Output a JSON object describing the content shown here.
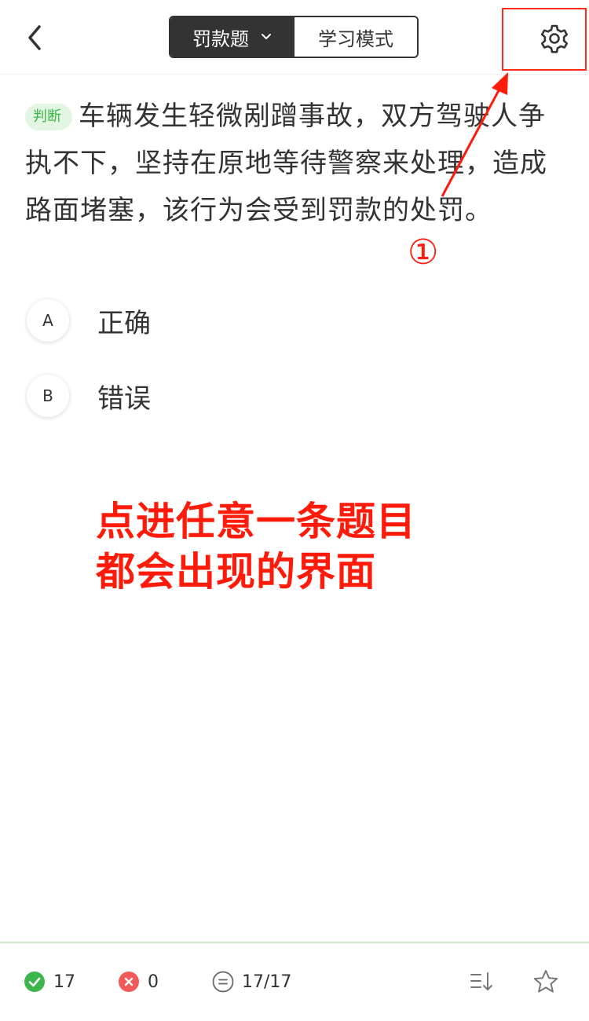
{
  "header": {
    "mode_left_label": "罚款题",
    "mode_right_label": "学习模式"
  },
  "question": {
    "type_tag": "判断",
    "text": "车辆发生轻微剐蹭事故，双方驾驶人争执不下，坚持在原地等待警察来处理，造成路面堵塞，该行为会受到罚款的处罚。"
  },
  "options": [
    {
      "letter": "A",
      "text": "正确"
    },
    {
      "letter": "B",
      "text": "错误"
    }
  ],
  "annotation": {
    "number": "①",
    "line1": "点进任意一条题目",
    "line2": "都会出现的界面",
    "color": "#ff1a0a"
  },
  "footer": {
    "correct_count": "17",
    "wrong_count": "0",
    "progress": "17/17"
  },
  "icons": {
    "back": "back-arrow-icon",
    "settings": "gear-icon",
    "dropdown": "chevron-down-icon",
    "correct": "check-circle-icon",
    "wrong": "x-circle-icon",
    "progress": "list-circle-icon",
    "sort": "sort-list-icon",
    "favorite": "star-icon"
  },
  "colors": {
    "accent_green": "#3cb54a",
    "error_red": "#f25a5a",
    "tag_bg": "#e2f6e3"
  }
}
